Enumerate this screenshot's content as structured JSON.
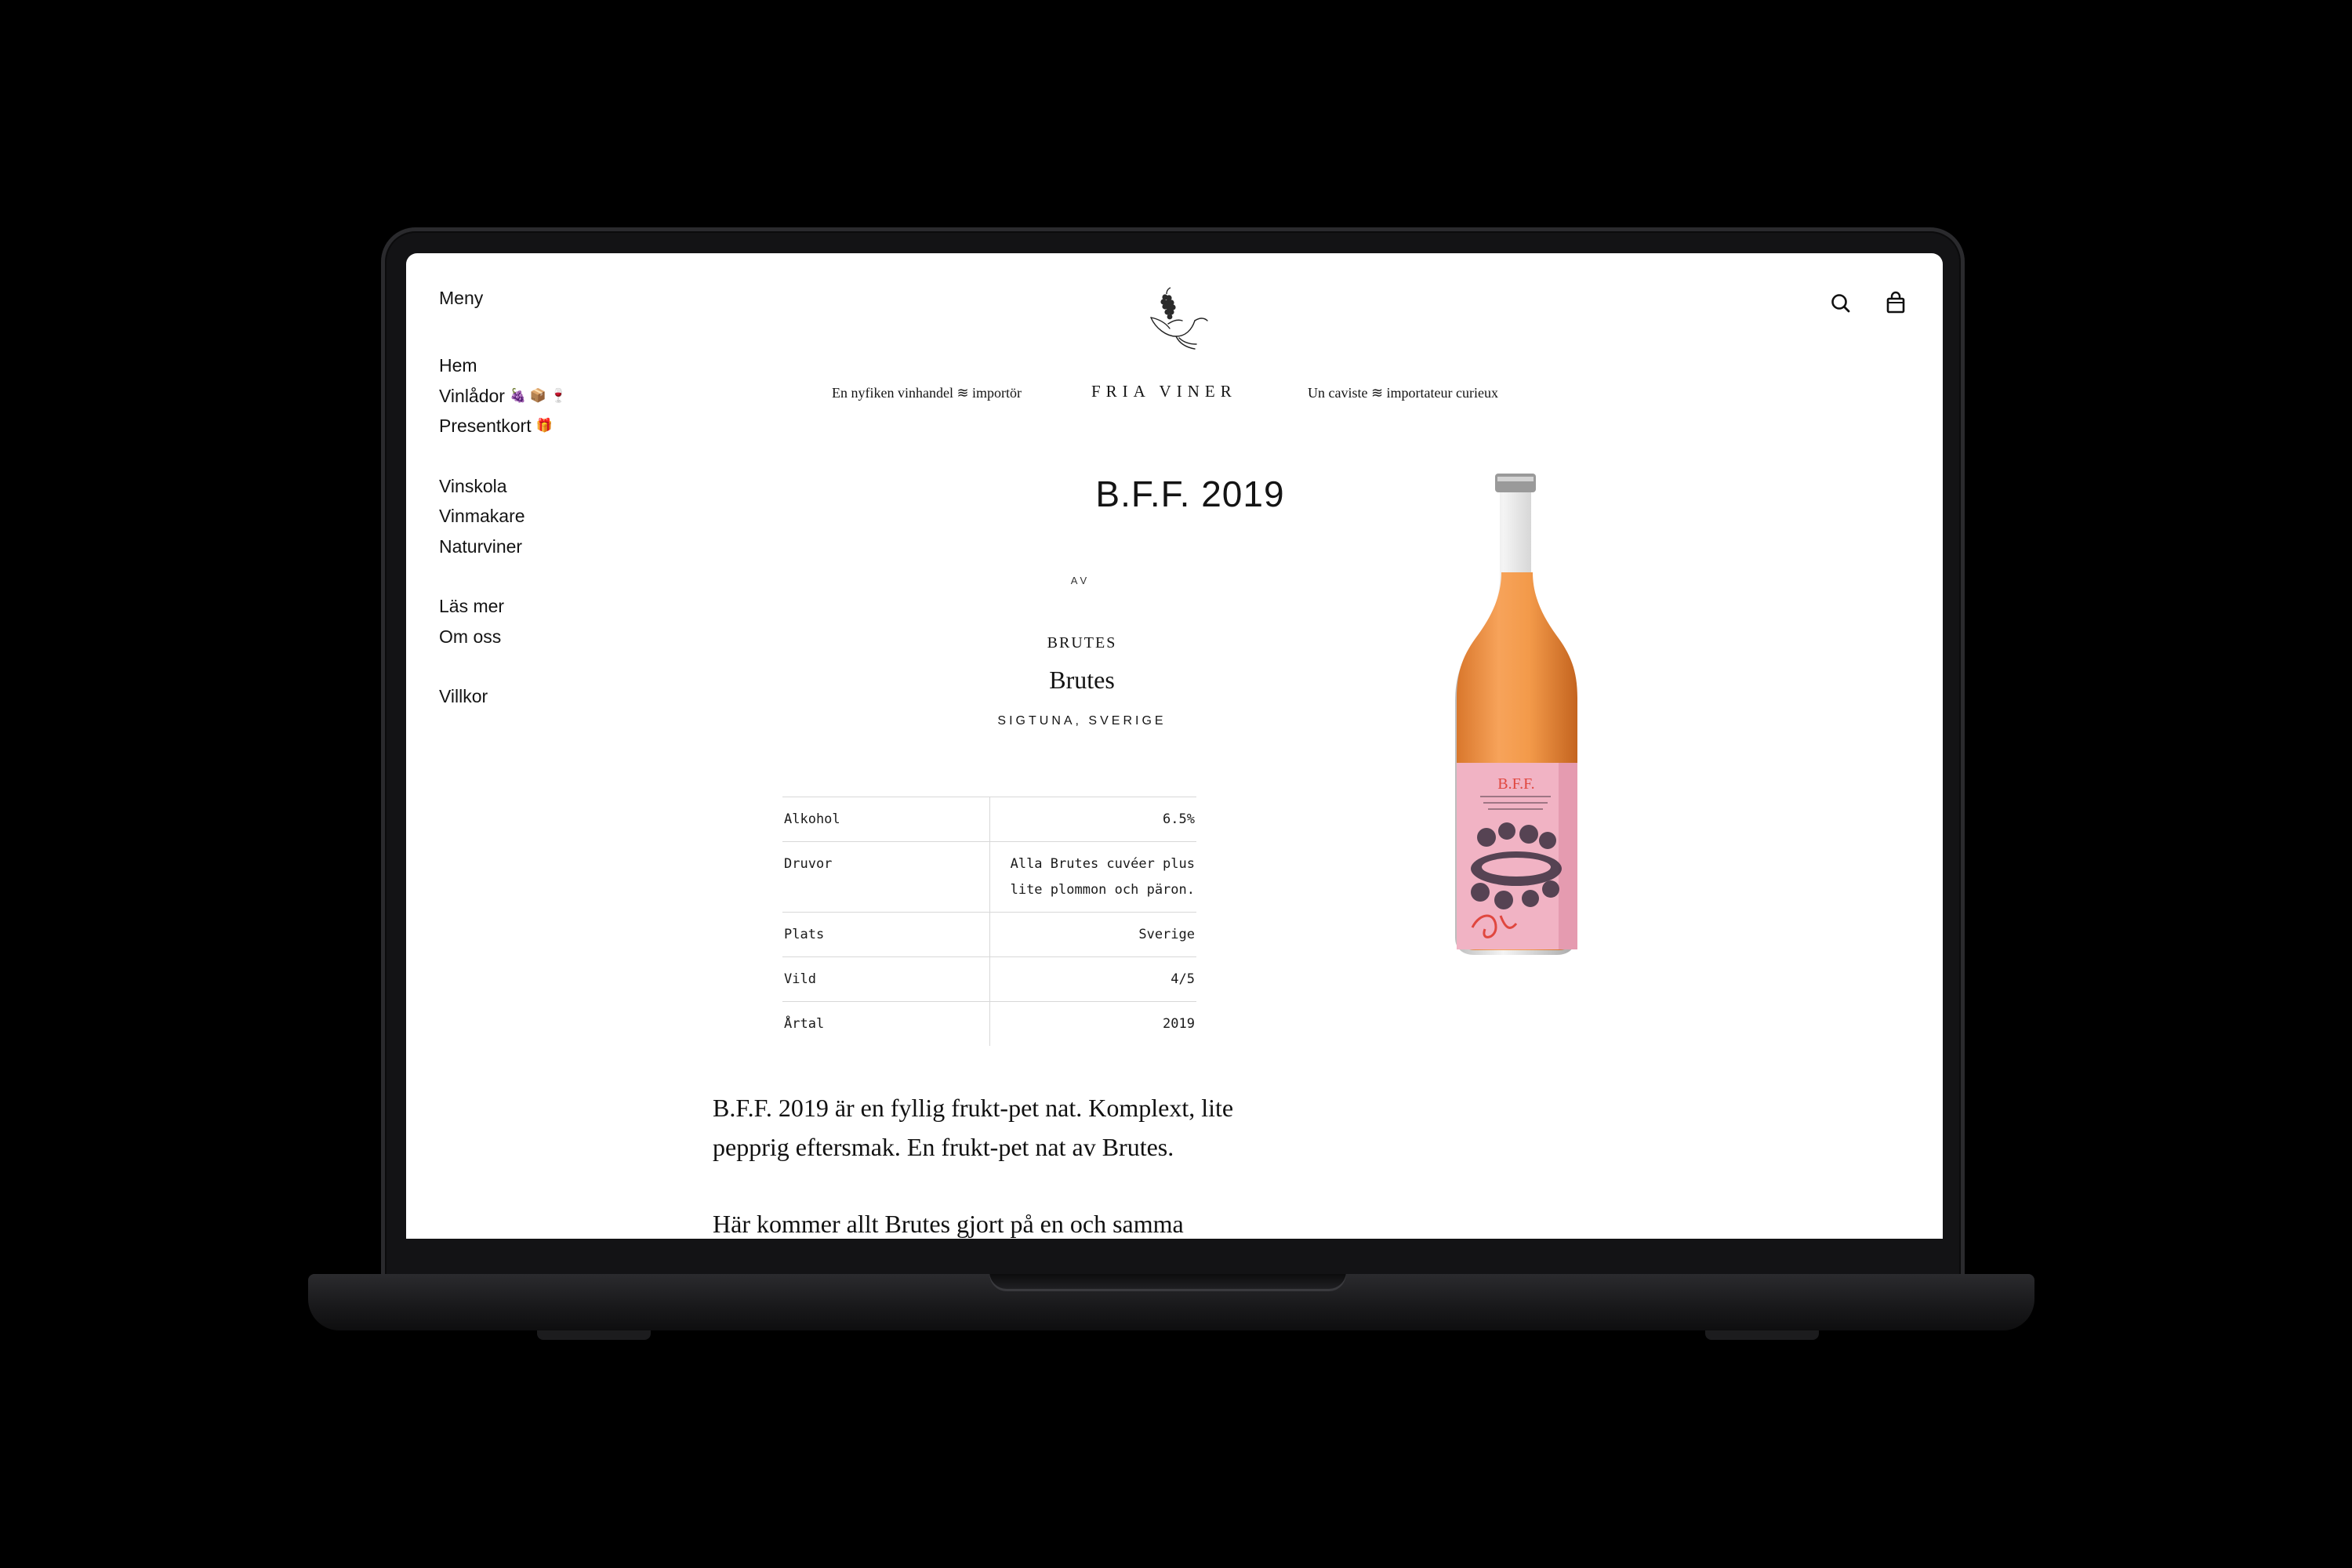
{
  "header": {
    "menu_label": "Meny",
    "brand": "FRIA VINER",
    "tagline_left": "En nyfiken vinhandel ≋ importör",
    "tagline_right": "Un caviste ≋ importateur curieux",
    "icons": [
      "search-icon",
      "cart-icon"
    ]
  },
  "nav": {
    "group1": [
      {
        "label": "Hem",
        "emoji": ""
      },
      {
        "label": "Vinlådor",
        "emoji": "🍇 📦 🍷"
      },
      {
        "label": "Presentkort",
        "emoji": "🎁"
      }
    ],
    "group2": [
      {
        "label": "Vinskola"
      },
      {
        "label": "Vinmakare"
      },
      {
        "label": "Naturviner"
      }
    ],
    "group3": [
      {
        "label": "Läs mer"
      },
      {
        "label": "Om oss"
      }
    ],
    "group4": [
      {
        "label": "Villkor"
      }
    ]
  },
  "product": {
    "title": "B.F.F. 2019",
    "by": "AV",
    "producer_caps": "BRUTES",
    "producer": "Brutes",
    "region": "SIGTUNA, SVERIGE",
    "label_text": "B.F.F.",
    "specs": [
      {
        "key": "Alkohol",
        "value": "6.5%"
      },
      {
        "key": "Druvor",
        "value": "Alla Brutes cuvéer plus lite plommon och päron."
      },
      {
        "key": "Plats",
        "value": "Sverige"
      },
      {
        "key": "Vild",
        "value": "4/5"
      },
      {
        "key": "Årtal",
        "value": "2019"
      }
    ],
    "description_1": "B.F.F. 2019 är en fyllig frukt-pet nat. Komplext, lite pepprig eftersmak. En frukt-pet nat av Brutes.",
    "description_2": "Här kommer allt Brutes gjort på en och samma"
  },
  "colors": {
    "background": "#000000",
    "screen": "#ffffff",
    "wine": "#f39a4a",
    "label": "#f1b3c4",
    "label_text": "#e0473f"
  }
}
